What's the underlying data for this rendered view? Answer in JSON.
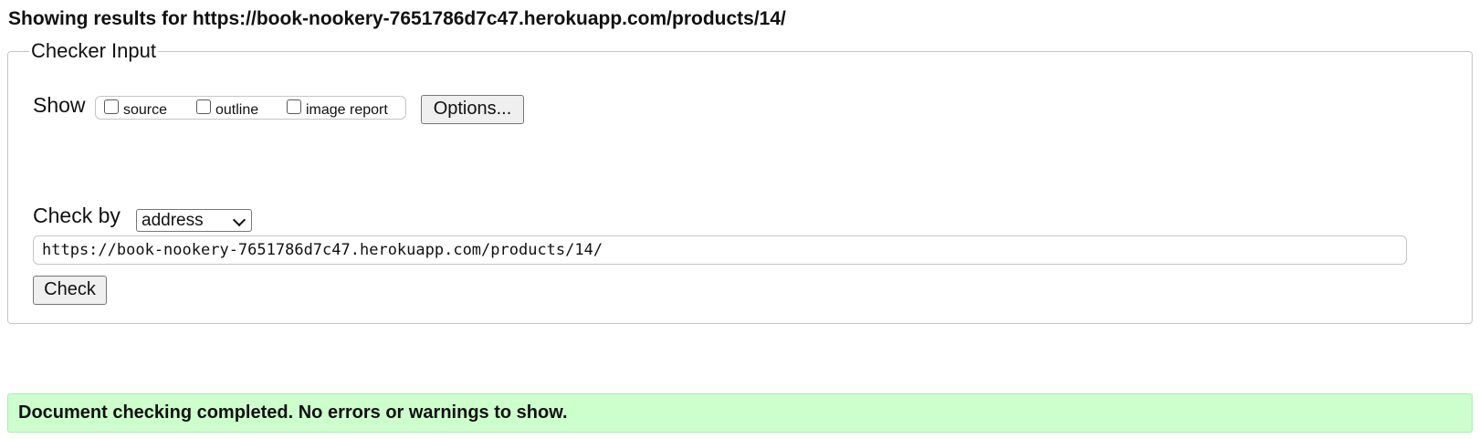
{
  "header": {
    "title": "Showing results for https://book-nookery-7651786d7c47.herokuapp.com/products/14/"
  },
  "checker_input": {
    "legend": "Checker Input",
    "show_label": "Show",
    "show_options": [
      {
        "label": "source",
        "checked": false
      },
      {
        "label": "outline",
        "checked": false
      },
      {
        "label": "image report",
        "checked": false
      }
    ],
    "options_button": "Options...",
    "check_by_label": "Check by",
    "check_by_value": "address",
    "url_value": "https://book-nookery-7651786d7c47.herokuapp.com/products/14/",
    "check_button": "Check"
  },
  "status": {
    "message": "Document checking completed. No errors or warnings to show.",
    "color": "#ccffcc"
  },
  "icons": {
    "select_arrow": "chevron-down-icon"
  }
}
